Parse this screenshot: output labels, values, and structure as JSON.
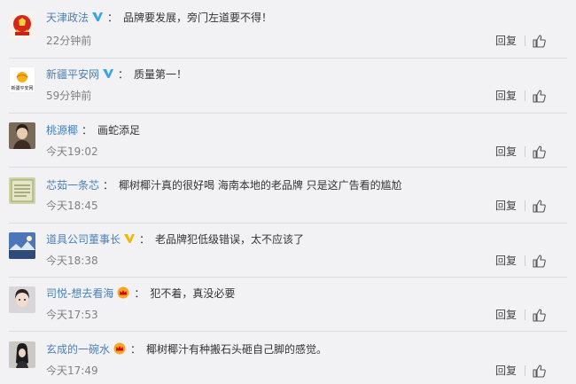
{
  "comments": [
    {
      "user": "天津政法",
      "badge": "verified",
      "text": "品牌要发展，旁门左道要不得！",
      "time": "22分钟前",
      "reply": "回复"
    },
    {
      "user": "新疆平安网",
      "badge": "verified",
      "text": "质量第一！",
      "time": "59分钟前",
      "reply": "回复",
      "avatar_text": "新疆平安网"
    },
    {
      "user": "桃源椰",
      "badge": "none",
      "text": "画蛇添足",
      "time": "今天19:02",
      "reply": "回复"
    },
    {
      "user": "芯茹一条芯",
      "badge": "none",
      "text": "椰树椰汁真的很好喝 海南本地的老品牌 只是这广告看的尴尬",
      "time": "今天18:45",
      "reply": "回复"
    },
    {
      "user": "道具公司董事长",
      "badge": "verified-yellow",
      "text": "老品牌犯低级错误，太不应该了",
      "time": "今天18:38",
      "reply": "回复"
    },
    {
      "user": "司悦-想去看海",
      "badge": "crown",
      "text": "犯不着，真没必要",
      "time": "今天17:53",
      "reply": "回复"
    },
    {
      "user": "玄成的一碗水",
      "badge": "crown",
      "text": "椰树椰汁有种搬石头砸自己脚的感觉。",
      "time": "今天17:49",
      "reply": "回复"
    }
  ],
  "colors": {
    "username": "#eb7350",
    "verified_blue": "#39a5e8",
    "verified_yellow": "#f5b800",
    "background": "#f2f2f5"
  },
  "icons": {
    "like": "thumbs-up-icon",
    "verified": "verified-v-icon",
    "crown": "crown-badge-icon"
  }
}
